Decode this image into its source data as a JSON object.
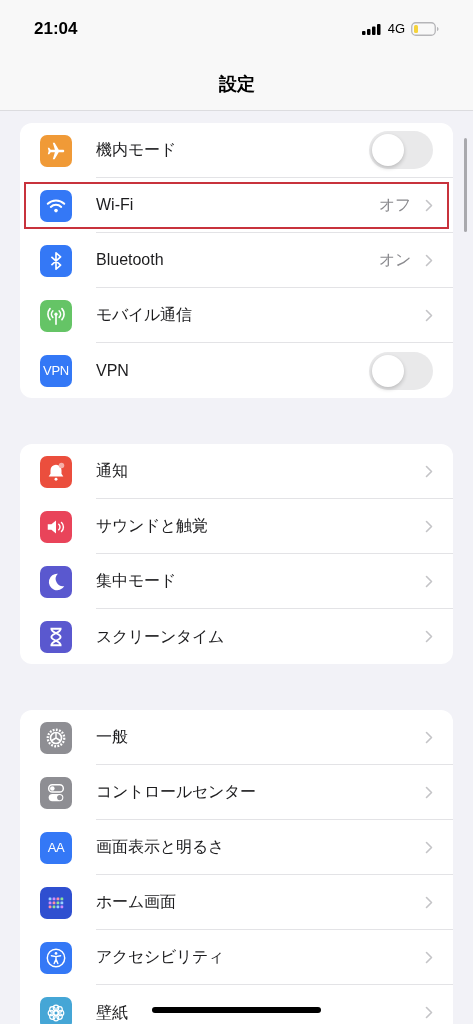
{
  "status_bar": {
    "time": "21:04",
    "network": "4G"
  },
  "title": "設定",
  "groups": [
    {
      "rows": [
        {
          "kind": "toggle",
          "label": "機内モード",
          "on": false,
          "color": "#f09a37",
          "highlighted": false
        },
        {
          "kind": "link",
          "label": "Wi-Fi",
          "value": "オフ",
          "color": "#3478f6",
          "highlighted": true
        },
        {
          "kind": "link",
          "label": "Bluetooth",
          "value": "オン",
          "color": "#3478f6",
          "highlighted": false
        },
        {
          "kind": "link",
          "label": "モバイル通信",
          "color": "#65c466",
          "highlighted": false
        },
        {
          "kind": "toggle",
          "label": "VPN",
          "on": false,
          "color": "#3478f6",
          "icon_text": "VPN",
          "highlighted": false
        }
      ]
    },
    {
      "rows": [
        {
          "kind": "link",
          "label": "通知",
          "color": "#eb4e3d",
          "highlighted": false
        },
        {
          "kind": "link",
          "label": "サウンドと触覚",
          "color": "#e9445a",
          "highlighted": false
        },
        {
          "kind": "link",
          "label": "集中モード",
          "color": "#5a58cf",
          "highlighted": false
        },
        {
          "kind": "link",
          "label": "スクリーンタイム",
          "color": "#5a58cf",
          "highlighted": false
        }
      ]
    },
    {
      "rows": [
        {
          "kind": "link",
          "label": "一般",
          "color": "#8e8e93",
          "highlighted": false
        },
        {
          "kind": "link",
          "label": "コントロールセンター",
          "color": "#8e8e93",
          "highlighted": false
        },
        {
          "kind": "link",
          "label": "画面表示と明るさ",
          "color": "#3478f6",
          "icon_text": "AA",
          "highlighted": false
        },
        {
          "kind": "link",
          "label": "ホーム画面",
          "color": "#2f4fd0",
          "highlighted": false
        },
        {
          "kind": "link",
          "label": "アクセシビリティ",
          "color": "#3478f6",
          "highlighted": false
        },
        {
          "kind": "link",
          "label": "壁紙",
          "color": "#45a6d6",
          "highlighted": false
        }
      ]
    }
  ]
}
